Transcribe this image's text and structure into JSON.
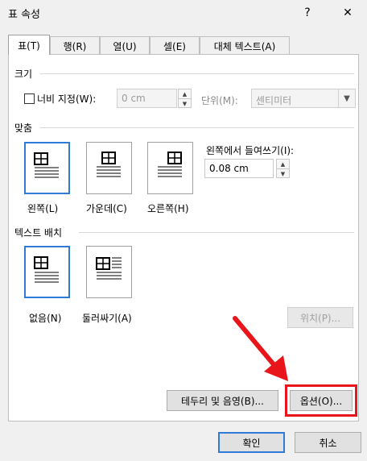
{
  "window": {
    "title": "표 속성",
    "help_label": "?",
    "close_label": "✕"
  },
  "tabs": [
    {
      "label": "표(T)"
    },
    {
      "label": "행(R)"
    },
    {
      "label": "열(U)"
    },
    {
      "label": "셀(E)"
    },
    {
      "label": "대체 텍스트(A)"
    }
  ],
  "size": {
    "section_label": "크기",
    "width_checkbox_label": "너비 지정(W):",
    "width_checked": false,
    "width_value": "0 cm",
    "unit_label": "단위(M):",
    "unit_value": "센티미터"
  },
  "alignment": {
    "section_label": "맞춤",
    "options": [
      "왼쪽(L)",
      "가운데(C)",
      "오른쪽(H)"
    ],
    "selected": "왼쪽(L)",
    "indent_label": "왼쪽에서 들여쓰기(I):",
    "indent_value": "0.08 cm"
  },
  "wrap": {
    "section_label": "텍스트 배치",
    "options": [
      "없음(N)",
      "둘러싸기(A)"
    ],
    "selected": "없음(N)",
    "position_button": "위치(P)..."
  },
  "buttons": {
    "borders_shading": "테두리 및 음영(B)...",
    "options": "옵션(O)...",
    "ok": "확인",
    "cancel": "취소"
  },
  "colors": {
    "highlight": "#e8161b",
    "accent": "#2f7bd6"
  }
}
